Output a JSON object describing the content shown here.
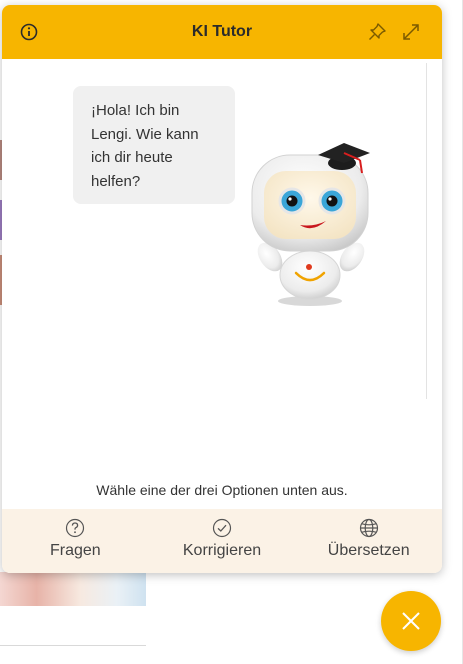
{
  "header": {
    "title": "KI Tutor",
    "accent": "#f7b500"
  },
  "chat": {
    "bot_message": "¡Hola! Ich bin Lengi. Wie kann ich dir heute helfen?",
    "hint": "Wähle eine der drei Optionen unten aus."
  },
  "options": [
    {
      "label": "Fragen",
      "icon": "question-icon"
    },
    {
      "label": "Korrigieren",
      "icon": "check-circle-icon"
    },
    {
      "label": "Übersetzen",
      "icon": "globe-icon"
    }
  ],
  "icons": {
    "info": "info-icon",
    "pin": "pin-icon",
    "expand": "expand-icon",
    "close": "close-icon"
  }
}
